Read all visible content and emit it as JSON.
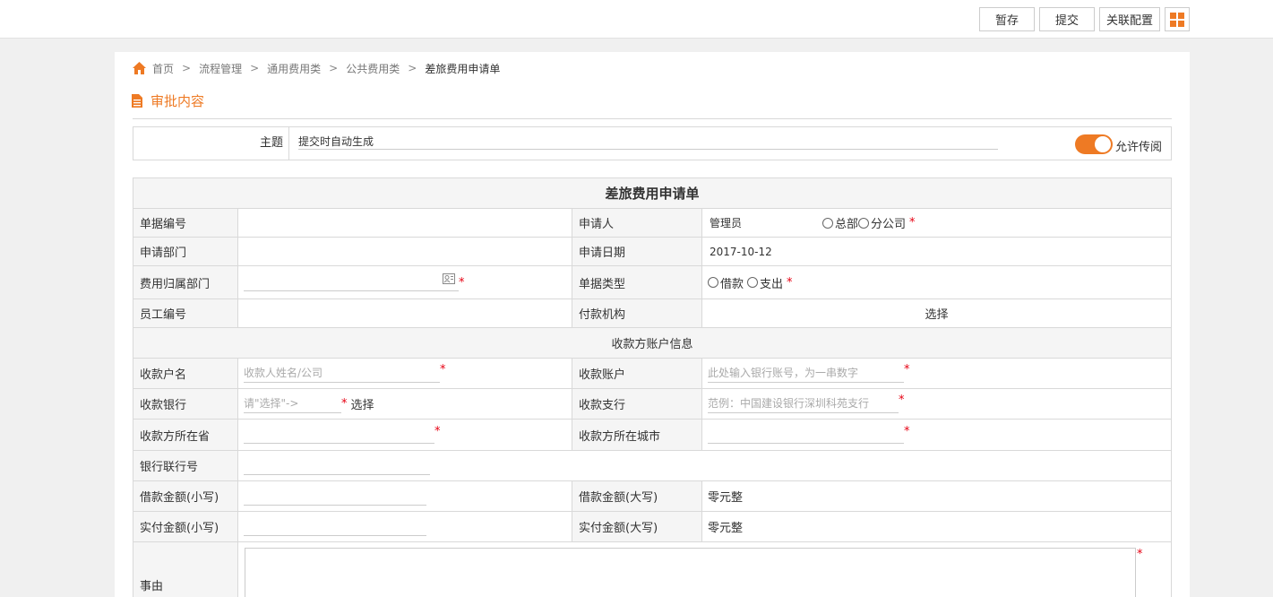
{
  "toolbar": {
    "save_draft": "暂存",
    "submit": "提交",
    "related_config": "关联配置",
    "grid_icon": "grid-icon",
    "accent": "#ee7a24"
  },
  "breadcrumb": {
    "items": [
      "首页",
      "流程管理",
      "通用费用类",
      "公共费用类"
    ],
    "current": "差旅费用申请单",
    "separator": ">"
  },
  "section": {
    "title": "审批内容"
  },
  "subject": {
    "label": "主题",
    "value": "提交时自动生成",
    "allow_forward_label": "允许传阅",
    "allow_forward_on": true
  },
  "form": {
    "title": "差旅费用申请单",
    "doc_no_label": "单据编号",
    "doc_no_value": "",
    "applicant_label": "申请人",
    "applicant_value": "管理员",
    "radio_hq": "总部",
    "radio_branch": "分公司",
    "dept_label": "申请部门",
    "dept_value": "",
    "apply_date_label": "申请日期",
    "apply_date_value": "2017-10-12",
    "cost_dept_label": "费用归属部门",
    "doc_type_label": "单据类型",
    "radio_loan": "借款",
    "radio_expense": "支出",
    "emp_no_label": "员工编号",
    "payer_org_label": "付款机构",
    "payer_org_select": "选择",
    "payee_section": "收款方账户信息",
    "payee_name_label": "收款户名",
    "payee_name_placeholder": "收款人姓名/公司",
    "payee_account_label": "收款账户",
    "payee_account_placeholder": "此处输入银行账号，为一串数字",
    "bank_label": "收款银行",
    "bank_placeholder": "请\"选择\"->",
    "bank_select": "选择",
    "branch_label": "收款支行",
    "branch_placeholder": "范例：中国建设银行深圳科苑支行",
    "province_label": "收款方所在省",
    "city_label": "收款方所在城市",
    "bank_code_label": "银行联行号",
    "loan_small_label": "借款金额(小写)",
    "loan_big_label": "借款金额(大写)",
    "loan_big_value": "零元整",
    "paid_small_label": "实付金额(小写)",
    "paid_big_label": "实付金额(大写)",
    "paid_big_value": "零元整",
    "reason_label": "事由",
    "required_mark": "*"
  }
}
